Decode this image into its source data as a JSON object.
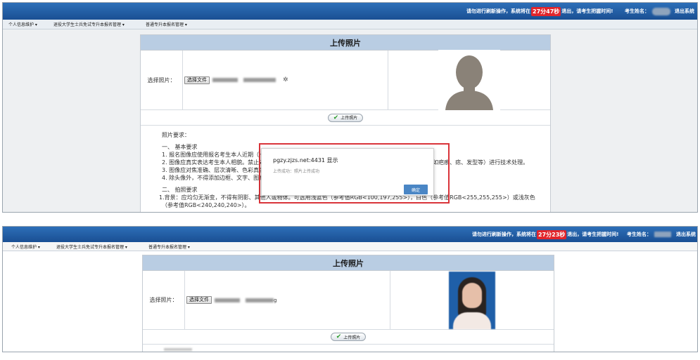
{
  "shot1": {
    "topbar": {
      "notice_prefix": "请勿进行刷新操作，系统将在",
      "countdown": "27分47秒",
      "notice_suffix": "退出，请考生把握时间!",
      "student_label": "考生姓名：",
      "logout": "退出系统"
    },
    "menu": [
      "个人信息维护 ▾",
      "退役大学生士兵免试专升本报名管理 ▾",
      "普通专升本报名管理 ▾"
    ],
    "panel": {
      "title": "上传照片",
      "select_label": "选择照片：",
      "file_button": "选择文件",
      "upload_button": "上传照片"
    },
    "requirements": [
      "照片要求：",
      "",
      "一、 基本要求",
      "1. 报名图像应使用报名考生本人近期（一",
      "2. 图像应真实表达考生本人相貌。禁止对",
      "3. 图像应对焦准确、层次清晰、色彩真实",
      "4. 除头像外，不得添加边框、文字、图案",
      "",
      "二、 拍照要求",
      "1.背景：应均匀无渐变，不得有阴影、其他人或物体。可选用浅蓝色（参考值RGB<100,197,255>），白色（参考值RGB<255,255,255>）或浅灰色",
      "（参考值RGB<240,240,240>）。"
    ],
    "requirements_tail": "(如疤痕、痣、发型等）进行技术处理。",
    "dialog": {
      "title": "pgzy.zjzs.net:4431 显示",
      "message": "上传成功：照片上传成功",
      "ok": "确定"
    }
  },
  "shot2": {
    "topbar": {
      "notice_prefix": "请勿进行刷新操作，系统将在",
      "countdown": "27分23秒",
      "notice_suffix": "退出，请考生把握时间!",
      "student_label": "考生姓名：",
      "logout": "退出系统"
    },
    "menu": [
      "个人信息维护 ▾",
      "退役大学生士兵免试专升本报名管理 ▾",
      "普通专升本报名管理 ▾"
    ],
    "panel": {
      "title": "上传照片",
      "select_label": "选择照片：",
      "file_button": "选择文件",
      "file_suffix": "g",
      "upload_button": "上传照片"
    }
  }
}
